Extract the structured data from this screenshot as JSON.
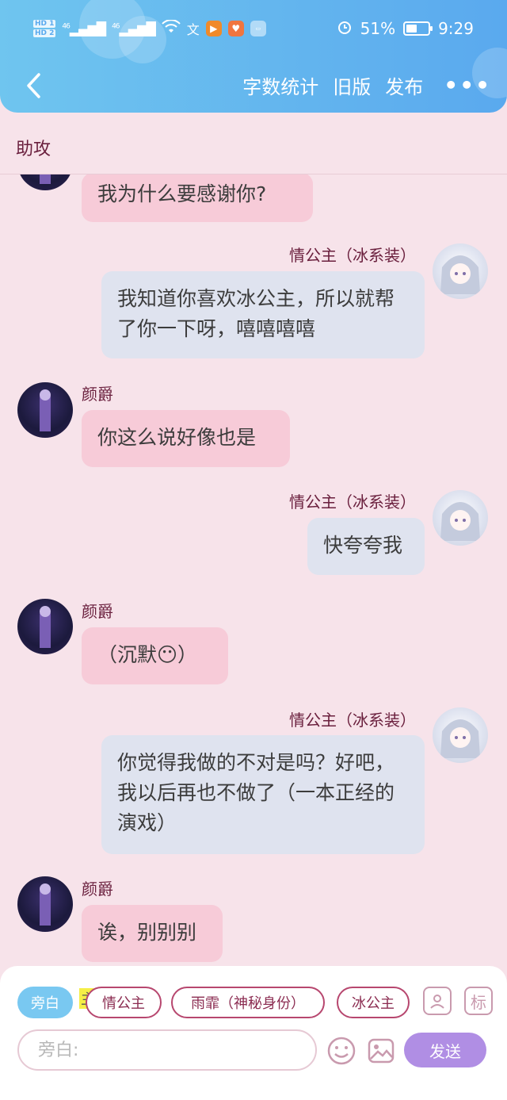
{
  "status_bar": {
    "hd1": "HD 1",
    "hd2": "HD 2",
    "signal1": "46",
    "signal2": "46",
    "battery_percent": "51%",
    "battery_level": 0.51,
    "time": "9:29"
  },
  "nav": {
    "word_count_label": "字数统计",
    "old_version_label": "旧版",
    "publish_label": "发布",
    "more_label": "•••"
  },
  "section_title": "助攻",
  "messages": [
    {
      "side": "left",
      "name": "",
      "text": "我为什么要感谢你?"
    },
    {
      "side": "right",
      "name": "情公主（冰系装）",
      "text": "我知道你喜欢冰公主，所以就帮了你一下呀，嘻嘻嘻嘻"
    },
    {
      "side": "left",
      "name": "颜爵",
      "text": "你这么说好像也是"
    },
    {
      "side": "right",
      "name": "情公主（冰系装）",
      "text": "快夸夸我"
    },
    {
      "side": "left",
      "name": "颜爵",
      "text": "（沉默😶）"
    },
    {
      "side": "right",
      "name": "情公主（冰系装）",
      "text": "你觉得我做的不对是吗？好吧，我以后再也不做了（一本正经的演戏）"
    },
    {
      "side": "left",
      "name": "颜爵",
      "text": "诶，别别别"
    }
  ],
  "composer": {
    "roles": [
      "旁白",
      "情公主",
      "雨霏（神秘身份）",
      "冰公主"
    ],
    "highlight_char": "主",
    "role_icon_label": "标",
    "input_placeholder": "旁白:",
    "send_label": "发送"
  },
  "colors": {
    "header_gradient_start": "#6fc5ef",
    "header_gradient_end": "#5aa9ee",
    "background": "#f7e3ea",
    "left_bubble": "#f7cbd8",
    "right_bubble": "#dfe3ef",
    "send_button": "#b08ee4"
  }
}
